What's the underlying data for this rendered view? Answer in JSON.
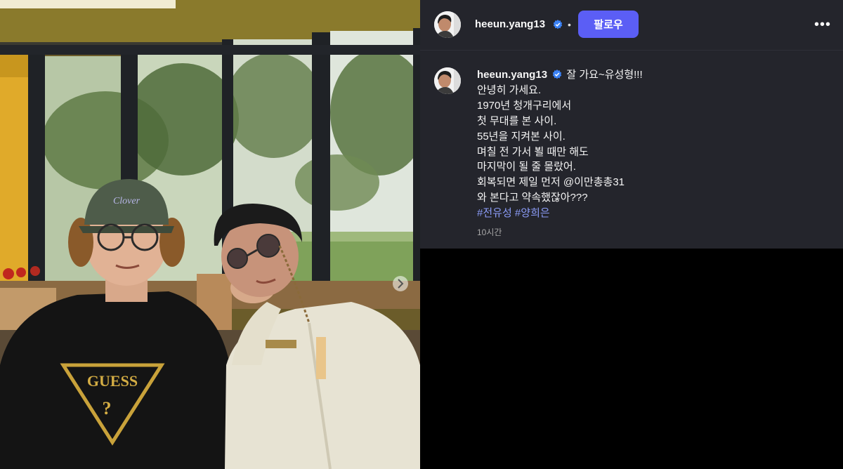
{
  "post": {
    "username": "heeun.yang13",
    "follow_label": "팔로우",
    "dot": "•",
    "more_label": "•••",
    "caption_first": "잘 가요~유성형!!!",
    "caption_lines": [
      "안녕히 가세요.",
      "1970년 청개구리에서",
      "첫 무대를 본 사이.",
      "55년을 지켜본 사이.",
      "며칠 전 가서 뵐 때만 해도",
      "마지막이 될 줄 몰랐어.",
      "회복되면 제일 먼저 @이만총총31",
      "와 본다고 약속했잖아???"
    ],
    "hashtags": [
      "#전유성",
      "#양희은"
    ],
    "timestamp": "10시간"
  },
  "photo": {
    "shirt_text": "GUESS",
    "cap_text": "Clover",
    "next_icon": "chevron-right-icon"
  },
  "colors": {
    "panel": "#24252c",
    "follow_button": "#5b5ef5",
    "verified": "#3b82f6",
    "hashtag": "#8b9cf8"
  }
}
